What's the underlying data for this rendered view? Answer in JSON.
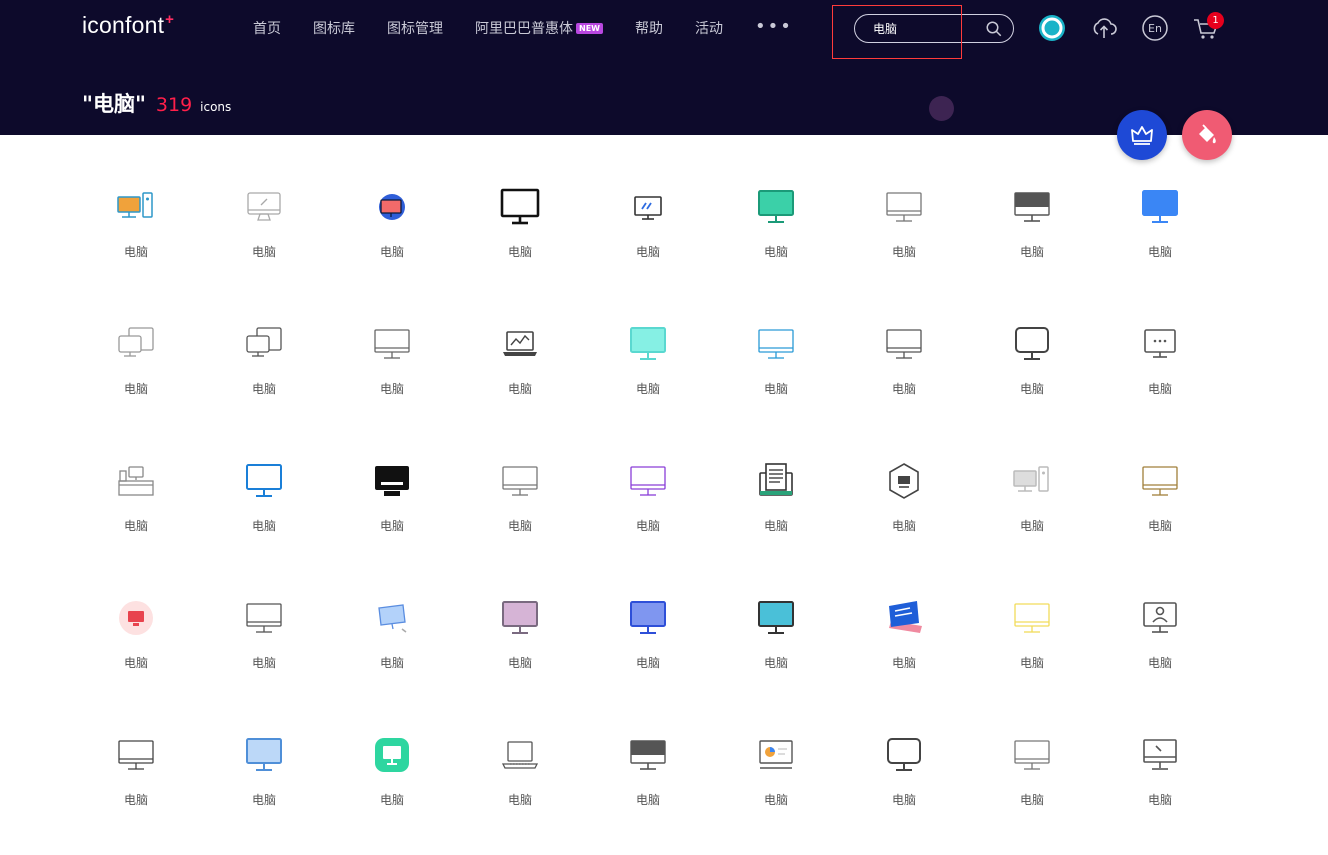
{
  "header": {
    "logo": "iconfont",
    "logo_plus": "+",
    "nav": [
      "首页",
      "图标库",
      "图标管理",
      "阿里巴巴普惠体",
      "帮助",
      "活动"
    ],
    "new_badge": "NEW",
    "more": "•••",
    "search_value": "电脑",
    "cart_count": "1",
    "lang_label": "En"
  },
  "results": {
    "query": "\"电脑\"",
    "count": "319",
    "unit": "icons"
  },
  "icon_label": "电脑",
  "icons": [
    {
      "s": "pc-set",
      "c": "#2d97c9",
      "a": "#f0a23b"
    },
    {
      "s": "imac",
      "c": "#a9a9a9"
    },
    {
      "s": "blob",
      "c": "#2f5ed8",
      "a": "#f36a6a"
    },
    {
      "s": "wide",
      "c": "#111111"
    },
    {
      "s": "mon-small",
      "c": "#333333",
      "a": "#2d6be0"
    },
    {
      "s": "mon-fill",
      "c": "#1b9a78",
      "a": "#3bd0a8"
    },
    {
      "s": "mon-thin",
      "c": "#777777"
    },
    {
      "s": "mon-head",
      "c": "#555555"
    },
    {
      "s": "mon-fill",
      "c": "#3a86f5",
      "a": "#3a86f5"
    },
    {
      "s": "duo",
      "c": "#999999"
    },
    {
      "s": "duo",
      "c": "#555555"
    },
    {
      "s": "mon-thin",
      "c": "#666666"
    },
    {
      "s": "laptop-chart",
      "c": "#444444"
    },
    {
      "s": "mon-fill",
      "c": "#5ad8d0",
      "a": "#86f0e4"
    },
    {
      "s": "mon-thin",
      "c": "#2a9ad6"
    },
    {
      "s": "mon-thin",
      "c": "#555555"
    },
    {
      "s": "rounded",
      "c": "#444444"
    },
    {
      "s": "mon-dots",
      "c": "#555555"
    },
    {
      "s": "desk",
      "c": "#888888"
    },
    {
      "s": "mon-fill",
      "c": "#1a7fd8",
      "a": "#ffffff"
    },
    {
      "s": "mon-solid",
      "c": "#111111"
    },
    {
      "s": "mon-thin",
      "c": "#777777"
    },
    {
      "s": "mon-thin",
      "c": "#8a3ed8"
    },
    {
      "s": "doc",
      "c": "#333333",
      "a": "#2aa37a"
    },
    {
      "s": "hex",
      "c": "#444444"
    },
    {
      "s": "pc-set",
      "c": "#bbbbbb",
      "a": "#dddddd"
    },
    {
      "s": "mon-thin",
      "c": "#a07f3a"
    },
    {
      "s": "circle-mon",
      "c": "#e8434e",
      "a": "#fde1e1"
    },
    {
      "s": "mon-thin",
      "c": "#555555"
    },
    {
      "s": "angled",
      "c": "#5a8de0",
      "a": "#b3d2fa"
    },
    {
      "s": "mon-fill",
      "c": "#7a6a80",
      "a": "#d6b4d6"
    },
    {
      "s": "mon-fill",
      "c": "#2e4fd8",
      "a": "#7f96f0"
    },
    {
      "s": "mon-fill",
      "c": "#333333",
      "a": "#4ac0d8"
    },
    {
      "s": "tilt",
      "c": "#1f5ed8",
      "a": "#f08aa0"
    },
    {
      "s": "mon-thin",
      "c": "#f2dc5a"
    },
    {
      "s": "user-mon",
      "c": "#555555"
    },
    {
      "s": "mon-thin",
      "c": "#444444"
    },
    {
      "s": "mon-fill",
      "c": "#4f8fd8",
      "a": "#bcd8f8"
    },
    {
      "s": "rounded-fill",
      "c": "#2ed6a0",
      "a": "#ffffff"
    },
    {
      "s": "laptop",
      "c": "#555555"
    },
    {
      "s": "mon-head",
      "c": "#555555"
    },
    {
      "s": "mon-chart",
      "c": "#555555",
      "a": "#f0a23b"
    },
    {
      "s": "rounded",
      "c": "#444444"
    },
    {
      "s": "mon-thin",
      "c": "#777777"
    },
    {
      "s": "mon-pen",
      "c": "#555555"
    }
  ],
  "colors": {
    "header_bg": "#0d0a2b",
    "accent_red": "#ff1f4a",
    "vip_blue": "#1e49d6",
    "theme_pink": "#f05b73"
  }
}
